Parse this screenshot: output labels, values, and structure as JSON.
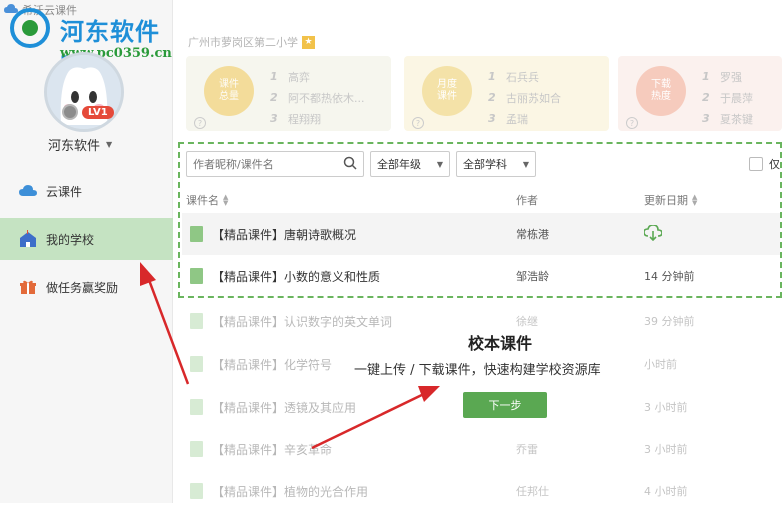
{
  "app": {
    "title": "希沃云课件"
  },
  "watermark": {
    "text": "河东软件园",
    "url": "www.pc0359.cn"
  },
  "user": {
    "level": "LV1",
    "name": "河东软件"
  },
  "sidebar": {
    "items": [
      {
        "label": "云课件",
        "icon": "cloud-icon"
      },
      {
        "label": "我的学校",
        "icon": "school-icon",
        "active": true
      },
      {
        "label": "做任务赢奖励",
        "icon": "gift-icon"
      }
    ]
  },
  "school": {
    "name": "广州市萝岗区第二小学"
  },
  "ranks": [
    {
      "badge": "课件\n总量",
      "color": "#f3c96a",
      "bg": "#f6f6ee",
      "entries": [
        "高弈",
        "阿不都热依木...",
        "程翔翔"
      ]
    },
    {
      "badge": "月度\n课件",
      "color": "#f2d07a",
      "bg": "#fbf6e4",
      "entries": [
        "石兵兵",
        "古丽苏如合",
        "孟瑞"
      ]
    },
    {
      "badge": "下载\n热度",
      "color": "#f3b3a0",
      "bg": "#fbf1ee",
      "entries": [
        "罗强",
        "于晨萍",
        "夏茶键"
      ]
    }
  ],
  "filters": {
    "search_placeholder": "作者昵称/课件名",
    "grade": "全部年级",
    "subject": "全部学科",
    "only_label": "仅"
  },
  "table": {
    "headers": {
      "name": "课件名",
      "author": "作者",
      "date": "更新日期"
    },
    "rows": [
      {
        "title": "【精品课件】唐朝诗歌概况",
        "author": "常栋港",
        "date": ""
      },
      {
        "title": "【精品课件】小数的意义和性质",
        "author": "邹浩龄",
        "date": "14 分钟前"
      },
      {
        "title": "【精品课件】认识数字的英文单词",
        "author": "徐继",
        "date": "39 分钟前"
      },
      {
        "title": "【精品课件】化学符号",
        "author": "",
        "date": "小时前"
      },
      {
        "title": "【精品课件】透镜及其应用",
        "author": "",
        "date": "3 小时前"
      },
      {
        "title": "【精品课件】辛亥革命",
        "author": "乔雷",
        "date": "3 小时前"
      },
      {
        "title": "【精品课件】植物的光合作用",
        "author": "任邦仕",
        "date": "4 小时前"
      }
    ]
  },
  "guide": {
    "title": "校本课件",
    "subtitle": "一键上传 / 下载课件，快速构建学校资源库",
    "next_label": "下一步"
  },
  "colors": {
    "accent": "#5aa852",
    "dashed": "#6ab55e",
    "active_nav": "#c5e3c2",
    "arrow": "#d8282a"
  }
}
